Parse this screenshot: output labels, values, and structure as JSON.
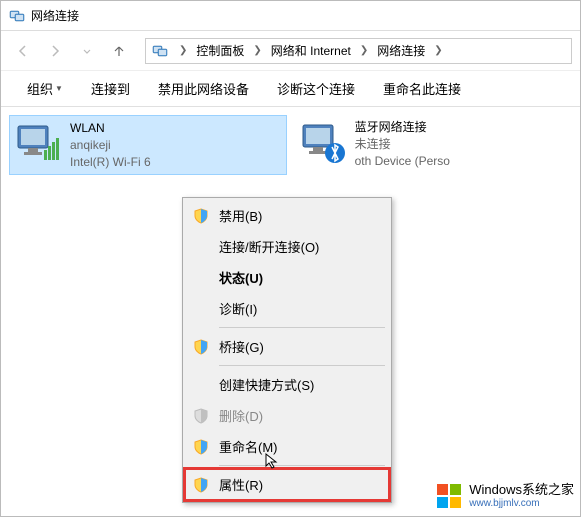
{
  "window": {
    "title": "网络连接"
  },
  "breadcrumb": {
    "items": [
      "控制面板",
      "网络和 Internet",
      "网络连接"
    ]
  },
  "toolbar": {
    "organize": "组织",
    "connect_to": "连接到",
    "disable": "禁用此网络设备",
    "diagnose": "诊断这个连接",
    "rename": "重命名此连接"
  },
  "connections": {
    "wlan": {
      "name": "WLAN",
      "ssid": "anqikeji",
      "adapter": "Intel(R) Wi-Fi 6"
    },
    "bluetooth": {
      "name": "蓝牙网络连接",
      "status": "未连接",
      "adapter": "oth Device (Perso"
    }
  },
  "context_menu": {
    "disable": "禁用(B)",
    "connect_disconnect": "连接/断开连接(O)",
    "status": "状态(U)",
    "diagnose": "诊断(I)",
    "bridge": "桥接(G)",
    "shortcut": "创建快捷方式(S)",
    "delete": "删除(D)",
    "rename": "重命名(M)",
    "properties": "属性(R)"
  },
  "watermark": {
    "main": "Windows系统之家",
    "url": "www.bjjmlv.com"
  }
}
